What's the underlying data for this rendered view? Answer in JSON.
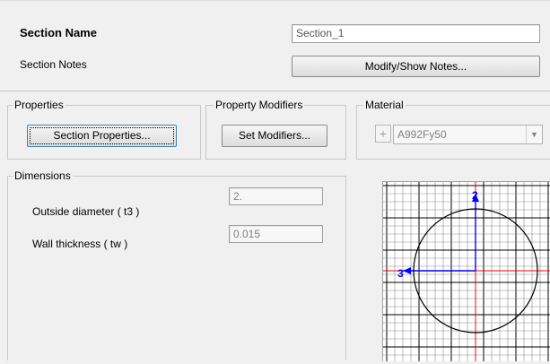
{
  "section": {
    "name_label": "Section Name",
    "name_value": "Section_1",
    "notes_label": "Section Notes",
    "notes_button": "Modify/Show Notes..."
  },
  "properties": {
    "legend": "Properties",
    "button": "Section Properties..."
  },
  "modifiers": {
    "legend": "Property Modifiers",
    "button": "Set Modifiers..."
  },
  "material": {
    "legend": "Material",
    "add_button": "+",
    "selected": "A992Fy50",
    "dropdown_icon": "chevron-down-icon"
  },
  "dimensions": {
    "legend": "Dimensions",
    "outside_diameter_label": "Outside diameter  ( t3 )",
    "outside_diameter_value": "2.",
    "wall_thickness_label": "Wall thickness  ( tw )",
    "wall_thickness_value": "0.015"
  },
  "preview": {
    "axis_vertical_label": "2",
    "axis_horizontal_label": "3",
    "colors": {
      "axis": "#0000ff",
      "accent_line": "#ff0000",
      "grid": "#8c8c8c",
      "shape": "#000000"
    }
  }
}
